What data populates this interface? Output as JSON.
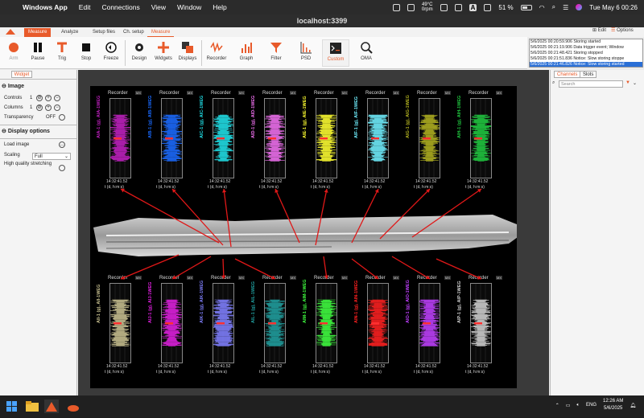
{
  "menubar": {
    "apple": "",
    "app_name": "Windows App",
    "items": [
      "Edit",
      "Connections",
      "View",
      "Window",
      "Help"
    ],
    "temperature": "49°C",
    "fan": "0rpm",
    "input_source": "A",
    "battery": "51 %",
    "datetime": "Tue May 6  00:26"
  },
  "window": {
    "title": "localhost:3399"
  },
  "ribbon": {
    "tabs": [
      "Measure",
      "Analyze",
      "Setup files",
      "Ch. setup",
      "Measure"
    ],
    "edit_label": "Edit",
    "options_label": "Options",
    "buttons": [
      {
        "label": "Arm",
        "icon": "arm-icon"
      },
      {
        "label": "Pause",
        "icon": "pause-icon"
      },
      {
        "label": "Trig",
        "icon": "trigger-icon"
      },
      {
        "label": "Stop",
        "icon": "stop-icon"
      },
      {
        "label": "Freeze",
        "icon": "freeze-icon"
      },
      {
        "label": "Design",
        "icon": "gear-icon"
      },
      {
        "label": "Widgets",
        "icon": "plus-icon"
      },
      {
        "label": "Displays",
        "icon": "displays-icon"
      },
      {
        "label": "Recorder",
        "icon": "recorder-icon"
      },
      {
        "label": "Graph",
        "icon": "graph-icon"
      },
      {
        "label": "Filter",
        "icon": "filter-icon"
      },
      {
        "label": "PSD",
        "icon": "psd-icon"
      },
      {
        "label": "Custom",
        "icon": "terminal-icon"
      },
      {
        "label": "OMA",
        "icon": "magnifier-icon"
      }
    ],
    "accent": "#e85a2a"
  },
  "log": [
    {
      "text": "5/6/2025 00:20:59.906 Storing started",
      "highlight": false
    },
    {
      "text": "5/6/2025 00:21:19.906 Data trigger event; Window",
      "highlight": false
    },
    {
      "text": "5/6/2025 00:21:48.421 Storing stopped",
      "highlight": false
    },
    {
      "text": "5/6/2025 00:21:51.836 Notice: Slow storing stoppe",
      "highlight": false
    },
    {
      "text": "5/6/2025 00:21:46.826 Notice: Slow storing started",
      "highlight": true
    }
  ],
  "left_panel": {
    "tab": "Widget",
    "image_header": "Image",
    "controls_label": "Controls",
    "controls_value": "1",
    "columns_label": "Columns",
    "columns_value": "1",
    "transparency_label": "Transparency",
    "transparency_value": "OFF",
    "display_header": "Display options",
    "load_image_label": "Load image",
    "scaling_label": "Scaling",
    "scaling_value": "Full",
    "hq_label": "High quality stretching"
  },
  "right_panel": {
    "tabs": [
      "Channels",
      "Slots"
    ],
    "search_placeholder": "Search"
  },
  "recorders": {
    "title": "Recorder",
    "max_label": "MX",
    "time_value": "14:32:41.52",
    "time_unit": "t (d, h:m:s)",
    "top": [
      {
        "label": "AIA-1 (g), AIA-1WEG",
        "color": "#c020c0"
      },
      {
        "label": "AIB-1 (g), AIB-1WEG",
        "color": "#1a6aff"
      },
      {
        "label": "AIC-1 (g), AIC-1WEG",
        "color": "#20e0e8"
      },
      {
        "label": "AID-1 (g), AID-1WEG",
        "color": "#f070f0"
      },
      {
        "label": "AIE-1 (g), AIE-1WEG",
        "color": "#ffff30"
      },
      {
        "label": "AIF-1 (g), AIF-1WEG",
        "color": "#70f0ff"
      },
      {
        "label": "AIG-1 (g), AIG-1WEG",
        "color": "#b0b020"
      },
      {
        "label": "AIH-1 (g), AIH-1WEG",
        "color": "#20c840"
      }
    ],
    "bottom": [
      {
        "label": "AII-1 (g), AII-1WEG",
        "color": "#c8c090"
      },
      {
        "label": "AIJ-1 (g), AIJ-1WEG",
        "color": "#e020e0"
      },
      {
        "label": "AIK-1 (g), AIK-1WEG",
        "color": "#8080ff"
      },
      {
        "label": "AIL-1 (g), AIL-1WEG",
        "color": "#20a0a0"
      },
      {
        "label": "AIM-1 (g), AIM-1WEG",
        "color": "#40ff40"
      },
      {
        "label": "AIN-1 (g), AIN-1WEG",
        "color": "#ff2020"
      },
      {
        "label": "AIO-1 (g), AIO-1WEG",
        "color": "#c040ff"
      },
      {
        "label": "AIP-1 (g), AIP-1WEG",
        "color": "#d0d0d0"
      }
    ]
  },
  "taskbar": {
    "language": "ENG",
    "time": "12:26 AM",
    "date": "5/6/2025"
  }
}
